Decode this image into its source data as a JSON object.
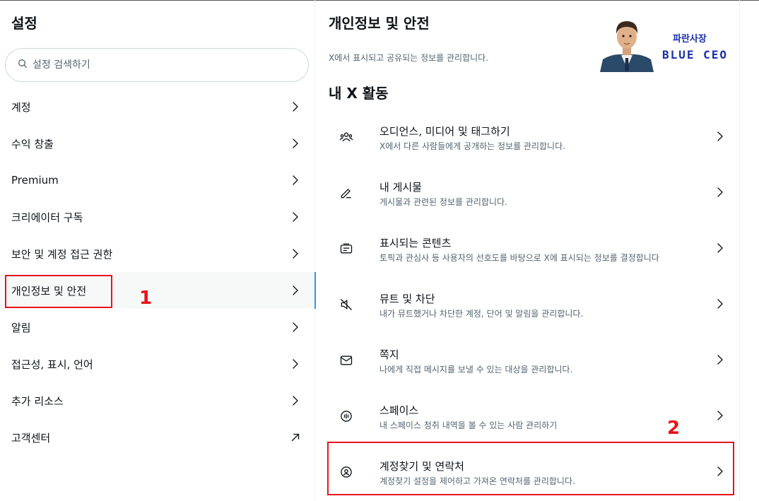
{
  "sidebar": {
    "title": "설정",
    "search_placeholder": "설정 검색하기",
    "items": [
      {
        "label": "계정",
        "icon": "chevron-right-icon"
      },
      {
        "label": "수익 창출",
        "icon": "chevron-right-icon"
      },
      {
        "label": "Premium",
        "icon": "chevron-right-icon"
      },
      {
        "label": "크리에이터 구독",
        "icon": "chevron-right-icon"
      },
      {
        "label": "보안 및 계정 접근 권한",
        "icon": "chevron-right-icon"
      },
      {
        "label": "개인정보 및 안전",
        "icon": "chevron-right-icon",
        "active": true
      },
      {
        "label": "알림",
        "icon": "chevron-right-icon"
      },
      {
        "label": "접근성, 표시, 언어",
        "icon": "chevron-right-icon"
      },
      {
        "label": "추가 리소스",
        "icon": "chevron-right-icon"
      },
      {
        "label": "고객센터",
        "icon": "external-link-icon"
      }
    ]
  },
  "main": {
    "title": "개인정보 및 안전",
    "subtitle": "X에서 표시되고 공유되는 정보를 관리합니다.",
    "section_title": "내 X 활동",
    "rows": [
      {
        "title": "오디언스, 미디어 및 태그하기",
        "desc": "X에서 다른 사람들에게 공개하는 정보를 관리합니다.",
        "icon": "people-icon"
      },
      {
        "title": "내 게시물",
        "desc": "게시물과 관련된 정보를 관리합니다.",
        "icon": "pencil-icon"
      },
      {
        "title": "표시되는 콘텐츠",
        "desc": "토픽과 관심사 등 사용자의 선호도를 바탕으로 X에 표시되는 정보를 결정합니다",
        "icon": "content-icon"
      },
      {
        "title": "뮤트 및 차단",
        "desc": "내가 뮤트했거나 차단한 계정, 단어 및 알림을 관리합니다.",
        "icon": "mute-icon"
      },
      {
        "title": "쪽지",
        "desc": "나에게 직접 메시지를 보낼 수 있는 대상을 관리합니다.",
        "icon": "envelope-icon"
      },
      {
        "title": "스페이스",
        "desc": "내 스페이스 청취 내역을 볼 수 있는 사람 관리하기",
        "icon": "spaces-icon"
      },
      {
        "title": "계정찾기 및 연락처",
        "desc": "계정찾기 설정을 제어하고 가져온 연락처를 관리합니다.",
        "icon": "discover-icon"
      }
    ]
  },
  "overlay": {
    "logo_name": "파란사장",
    "logo_sub": "BLUE CEO",
    "marker_1": "1",
    "marker_2": "2",
    "accent_color": "#1d9bf0",
    "highlight_color": "#e8141a"
  }
}
